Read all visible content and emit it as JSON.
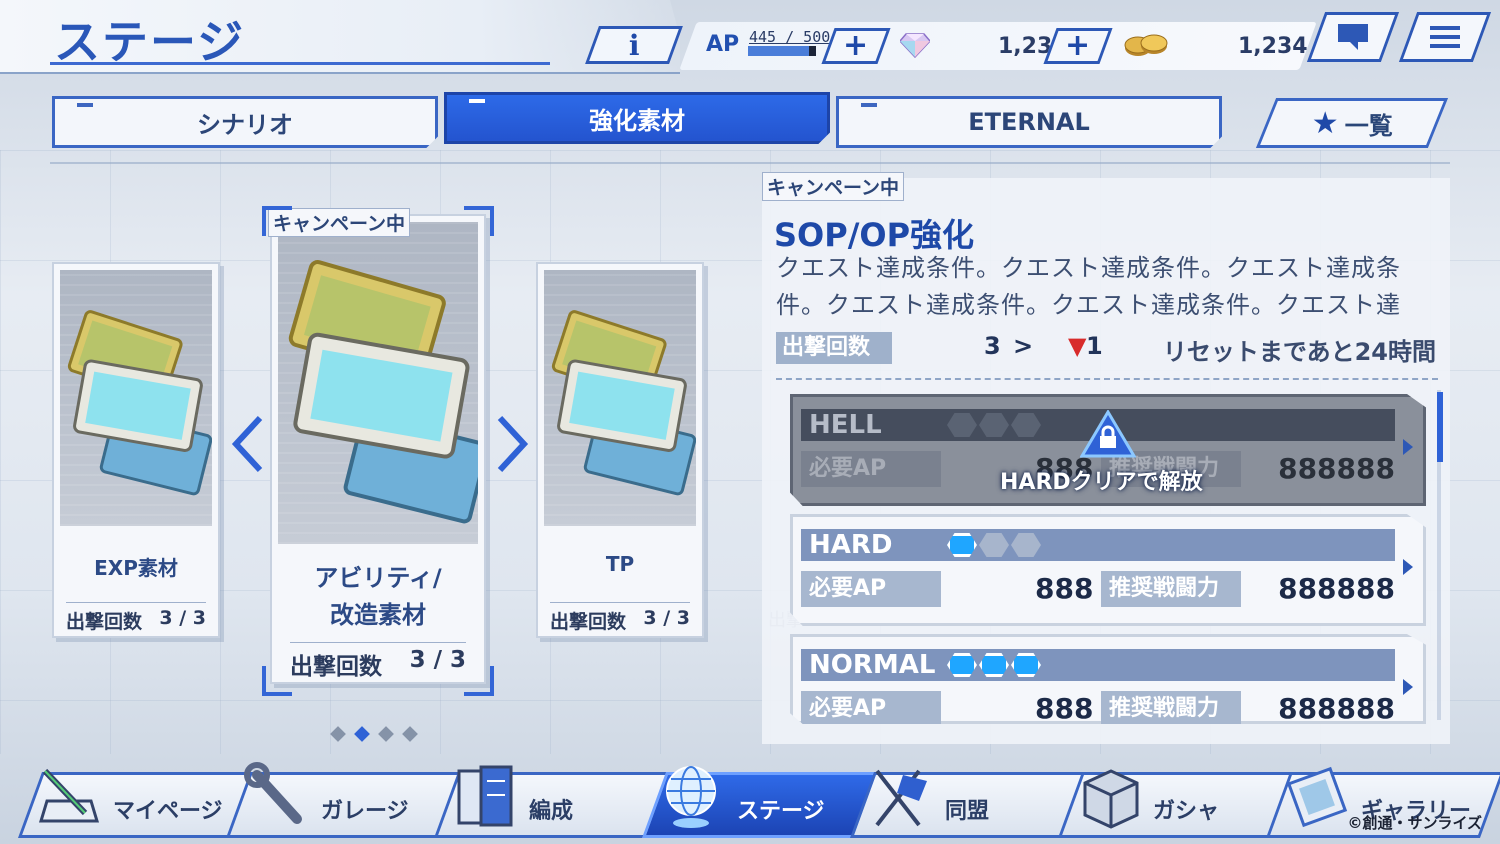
{
  "header": {
    "title": "ステージ",
    "info_label": "i",
    "ap_label": "AP",
    "ap_value": "445 / 500",
    "ap_progress": 0.89,
    "gems": "1,234",
    "coins": "1,234",
    "plus_label": "+"
  },
  "tabs": [
    {
      "label": "シナリオ",
      "active": false
    },
    {
      "label": "強化素材",
      "active": true
    },
    {
      "label": "ETERNAL",
      "active": false
    }
  ],
  "list_button": {
    "star": "★",
    "label": "一覧"
  },
  "carousel": {
    "cards": [
      {
        "title": "EXP素材",
        "sortie_label": "出撃回数",
        "sortie_value": "3 / 3"
      },
      {
        "title_line1": "アビリティ/",
        "title_line2": "改造素材",
        "sortie_label": "出撃回数",
        "sortie_value": "3 / 3",
        "tag": "キャンペーン中"
      },
      {
        "title": "TP",
        "sortie_label": "出撃回数",
        "sortie_value": "3 / 3"
      }
    ],
    "behind_label": "出撃",
    "dots": 4,
    "active_dot": 1
  },
  "detail": {
    "tag": "キャンペーン中",
    "title": "SOP/OP強化",
    "description": "クエスト達成条件。クエスト達成条件。クエスト達成条件。クエスト達成条件。クエスト達成条件。クエスト達",
    "sortie_label": "出撃回数",
    "sortie_current": "3",
    "sortie_arrow": ">",
    "sortie_down": "▼",
    "sortie_new": "1",
    "reset_text": "リセットまであと24時間",
    "difficulties": [
      {
        "name": "HELL",
        "stars": 0,
        "ap_label": "必要AP",
        "ap_value": "888",
        "power_label": "推奨戦闘力",
        "power_value": "888888",
        "locked": true,
        "lock_text": "HARDクリアで解放"
      },
      {
        "name": "HARD",
        "stars": 1,
        "ap_label": "必要AP",
        "ap_value": "888",
        "power_label": "推奨戦闘力",
        "power_value": "888888",
        "locked": false
      },
      {
        "name": "NORMAL",
        "stars": 3,
        "ap_label": "必要AP",
        "ap_value": "888",
        "power_label": "推奨戦闘力",
        "power_value": "888888",
        "locked": false
      }
    ]
  },
  "bottom_nav": [
    {
      "label": "マイページ",
      "icon": "mypage-icon",
      "active": false
    },
    {
      "label": "ガレージ",
      "icon": "wrench-icon",
      "active": false
    },
    {
      "label": "編成",
      "icon": "formation-icon",
      "active": false
    },
    {
      "label": "ステージ",
      "icon": "globe-icon",
      "active": true
    },
    {
      "label": "同盟",
      "icon": "alliance-flag-icon",
      "active": false
    },
    {
      "label": "ガシャ",
      "icon": "gacha-box-icon",
      "active": false
    },
    {
      "label": "ギャラリー",
      "icon": "gallery-card-icon",
      "active": false
    }
  ],
  "copyright": "©創通・サンライズ",
  "colors": {
    "accent": "#2f62d6",
    "accent_dark": "#1d44a8",
    "panel": "#f5f7fb",
    "bar": "#7e94bd",
    "locked": "#454d5d",
    "alert": "#d82b2b"
  }
}
